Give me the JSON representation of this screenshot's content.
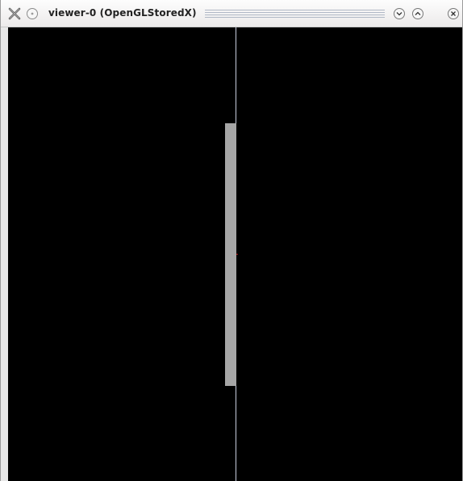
{
  "window": {
    "title": "viewer-0 (OpenGLStoredX)"
  },
  "icons": {
    "app": "x-app-icon",
    "menu": "window-menu-icon",
    "minimize": "minimize-icon",
    "maximize": "maximize-icon",
    "close": "close-icon"
  },
  "colors": {
    "viewport_background": "#000000",
    "axis_line": "#c7ccdc",
    "shape_fill": "#a6a6a6",
    "origin_marker": "#cc2222"
  }
}
